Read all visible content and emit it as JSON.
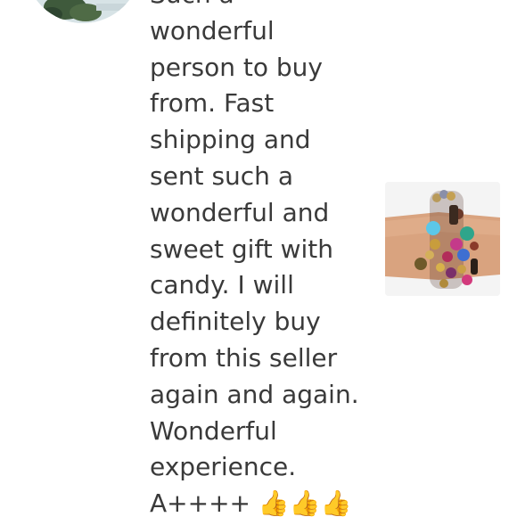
{
  "review": {
    "text": "Such a\nwonderful\nperson to buy\nfrom. Fast\nshipping and\nsent such a\nwonderful and\nsweet gift with\ncandy. I will\ndefinitely buy\nfrom this seller\nagain and again.\nWonderful\nexperience.\nA++++ 👍👍👍"
  },
  "reviewer": {
    "avatar_icon": "reviewer-avatar-photo"
  },
  "product": {
    "image_icon": "beaded-bracelet-photo"
  },
  "colors": {
    "background": "#ffffff",
    "text": "#3a3a3a"
  }
}
